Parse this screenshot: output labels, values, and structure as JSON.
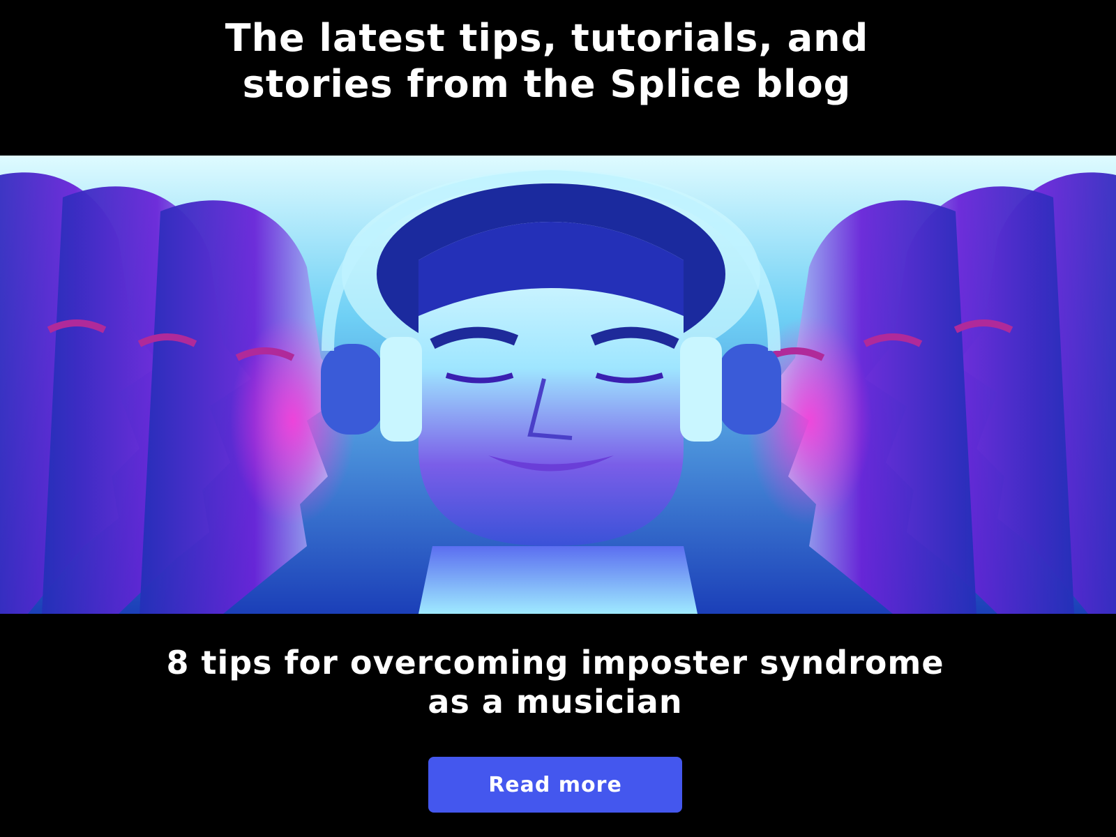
{
  "header": {
    "headline_line1": "The latest tips, tutorials, and",
    "headline_line2": "stories from the Splice blog"
  },
  "article": {
    "title_line1": "8 tips for overcoming imposter syndrome",
    "title_line2": "as a musician",
    "cta_label": "Read more"
  },
  "colors": {
    "background": "#000000",
    "text": "#ffffff",
    "button": "#4457ee",
    "hero_cyan": "#bff6ff",
    "hero_blue": "#2a3ad0",
    "hero_purple": "#7a22e0",
    "hero_magenta": "#d02ad8"
  }
}
